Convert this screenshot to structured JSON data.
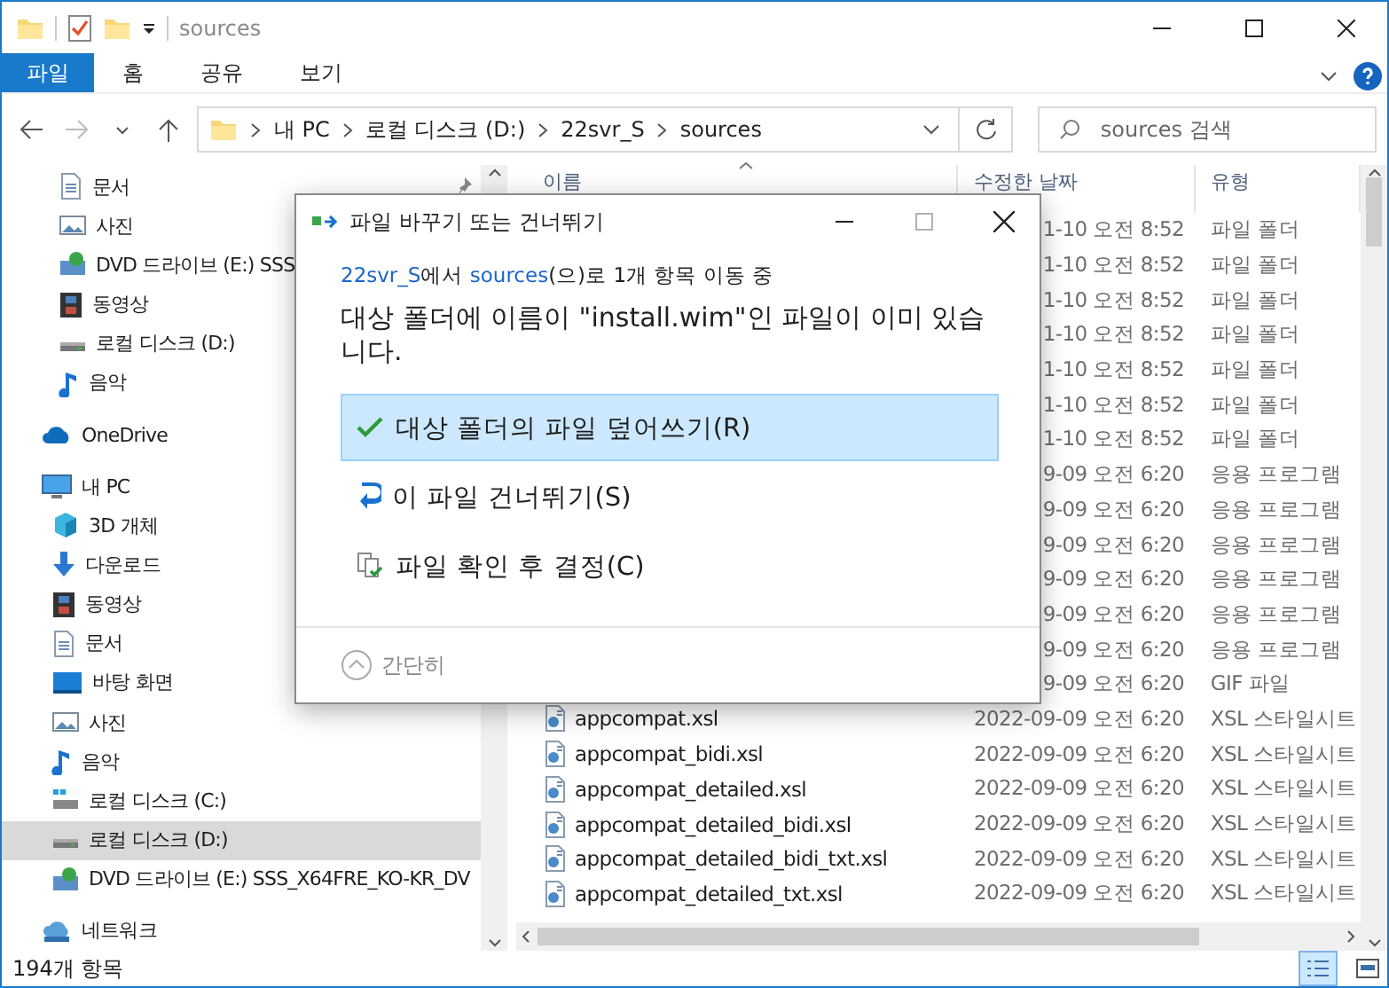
{
  "window": {
    "title": "sources"
  },
  "ribbon_tabs": [
    {
      "label": "파일",
      "selected": true
    },
    {
      "label": "홈",
      "selected": false
    },
    {
      "label": "공유",
      "selected": false
    },
    {
      "label": "보기",
      "selected": false
    }
  ],
  "address_bar": {
    "segments": [
      "내 PC",
      "로컬 디스크 (D:)",
      "22svr_S",
      "sources"
    ]
  },
  "search": {
    "placeholder": "sources 검색"
  },
  "nav": {
    "quick_access": [
      {
        "label": "문서",
        "kind": "document",
        "pinned": true,
        "selected": false
      },
      {
        "label": "사진",
        "kind": "picture",
        "pinned": false,
        "selected": false
      },
      {
        "label": "DVD 드라이브 (E:) SSS",
        "kind": "dvd",
        "pinned": false,
        "selected": false
      },
      {
        "label": "동영상",
        "kind": "video",
        "pinned": false,
        "selected": false
      },
      {
        "label": "로컬 디스크 (D:)",
        "kind": "drive",
        "pinned": false,
        "selected": false
      },
      {
        "label": "음악",
        "kind": "music",
        "pinned": false,
        "selected": false
      }
    ],
    "tree": [
      {
        "label": "OneDrive",
        "kind": "cloud",
        "selected": false
      },
      {
        "label": "내 PC",
        "kind": "pc",
        "selected": false,
        "children": [
          {
            "label": "3D 개체",
            "kind": "cube",
            "selected": false
          },
          {
            "label": "다운로드",
            "kind": "download",
            "selected": false
          },
          {
            "label": "동영상",
            "kind": "video",
            "selected": false
          },
          {
            "label": "문서",
            "kind": "document",
            "selected": false
          },
          {
            "label": "바탕 화면",
            "kind": "desktop",
            "selected": false
          },
          {
            "label": "사진",
            "kind": "picture",
            "selected": false
          },
          {
            "label": "음악",
            "kind": "music",
            "selected": false
          },
          {
            "label": "로컬 디스크 (C:)",
            "kind": "system_drive",
            "selected": false
          },
          {
            "label": "로컬 디스크 (D:)",
            "kind": "drive",
            "selected": true
          },
          {
            "label": "DVD 드라이브 (E:) SSS_X64FRE_KO-KR_DV",
            "kind": "dvd",
            "selected": false
          }
        ]
      },
      {
        "label": "네트워크",
        "kind": "network",
        "selected": false
      }
    ]
  },
  "file_list": {
    "columns": [
      {
        "label": "이름",
        "sorted": true
      },
      {
        "label": "수정한 날짜",
        "sorted": false
      },
      {
        "label": "유형",
        "sorted": false
      }
    ],
    "rows": [
      {
        "kind": "partial",
        "date": "1-10 오전 8:52",
        "type": "파일 폴더"
      },
      {
        "kind": "partial",
        "date": "1-10 오전 8:52",
        "type": "파일 폴더"
      },
      {
        "kind": "partial",
        "date": "1-10 오전 8:52",
        "type": "파일 폴더"
      },
      {
        "kind": "partial",
        "date": "1-10 오전 8:52",
        "type": "파일 폴더"
      },
      {
        "kind": "partial",
        "date": "1-10 오전 8:52",
        "type": "파일 폴더"
      },
      {
        "kind": "partial",
        "date": "1-10 오전 8:52",
        "type": "파일 폴더"
      },
      {
        "kind": "partial",
        "date": "1-10 오전 8:52",
        "type": "파일 폴더"
      },
      {
        "kind": "partial",
        "date": "9-09 오전 6:20",
        "type": "응용 프로그램"
      },
      {
        "kind": "partial",
        "date": "9-09 오전 6:20",
        "type": "응용 프로그램"
      },
      {
        "kind": "partial",
        "date": "9-09 오전 6:20",
        "type": "응용 프로그램"
      },
      {
        "kind": "partial",
        "date": "9-09 오전 6:20",
        "type": "응용 프로그램"
      },
      {
        "kind": "partial",
        "date": "9-09 오전 6:20",
        "type": "응용 프로그램"
      },
      {
        "kind": "partial",
        "date": "9-09 오전 6:20",
        "type": "응용 프로그램"
      },
      {
        "kind": "partial",
        "date": "9-09 오전 6:20",
        "type": "GIF 파일"
      },
      {
        "kind": "file",
        "name": "appcompat.xsl",
        "date": "2022-09-09 오전 6:20",
        "type": "XSL 스타일시트"
      },
      {
        "kind": "file",
        "name": "appcompat_bidi.xsl",
        "date": "2022-09-09 오전 6:20",
        "type": "XSL 스타일시트"
      },
      {
        "kind": "file",
        "name": "appcompat_detailed.xsl",
        "date": "2022-09-09 오전 6:20",
        "type": "XSL 스타일시트"
      },
      {
        "kind": "file",
        "name": "appcompat_detailed_bidi.xsl",
        "date": "2022-09-09 오전 6:20",
        "type": "XSL 스타일시트"
      },
      {
        "kind": "file",
        "name": "appcompat_detailed_bidi_txt.xsl",
        "date": "2022-09-09 오전 6:20",
        "type": "XSL 스타일시트"
      },
      {
        "kind": "file",
        "name": "appcompat_detailed_txt.xsl",
        "date": "2022-09-09 오전 6:20",
        "type": "XSL 스타일시트"
      }
    ]
  },
  "status_bar": {
    "item_count": "194개 항목",
    "views": [
      {
        "kind": "details",
        "selected": true
      },
      {
        "kind": "large_icons",
        "selected": false
      }
    ]
  },
  "dialog": {
    "title": "파일 바꾸기 또는 건너뛰기",
    "maximize_disabled": true,
    "progress": {
      "source": "22svr_S",
      "between": "에서 ",
      "destination": "sources",
      "after": "(으)로 1개 항목 이동 중"
    },
    "message": "대상 폴더에 이름이 \"install.wim\"인 파일이 이미 있습니다.",
    "options": [
      {
        "kind": "replace",
        "label": "대상 폴더의 파일 덮어쓰기(R)",
        "selected": true
      },
      {
        "kind": "skip",
        "label": "이 파일 건너뛰기(S)",
        "selected": false
      },
      {
        "kind": "compare",
        "label": "파일 확인 후 결정(C)",
        "selected": false
      }
    ],
    "footer": {
      "label": "간단히",
      "expanded": true
    }
  }
}
